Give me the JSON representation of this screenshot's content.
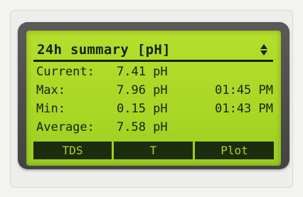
{
  "screen": {
    "title": "24h summary [pH]",
    "scroll_icon": "up-down-arrows-icon"
  },
  "readings": [
    {
      "label": "Current:",
      "value": "7.41 pH",
      "time": ""
    },
    {
      "label": "Max:",
      "value": "7.96 pH",
      "time": "01:45 PM"
    },
    {
      "label": "Min:",
      "value": "0.15 pH",
      "time": "01:43 PM"
    },
    {
      "label": "Average:",
      "value": "7.58 pH",
      "time": ""
    }
  ],
  "softkeys": [
    {
      "label": "TDS"
    },
    {
      "label": "T"
    },
    {
      "label": "Plot"
    }
  ],
  "colors": {
    "lcd_background": "#a9d725",
    "lcd_text": "#15230c",
    "bezel": "#4d4d4b"
  }
}
